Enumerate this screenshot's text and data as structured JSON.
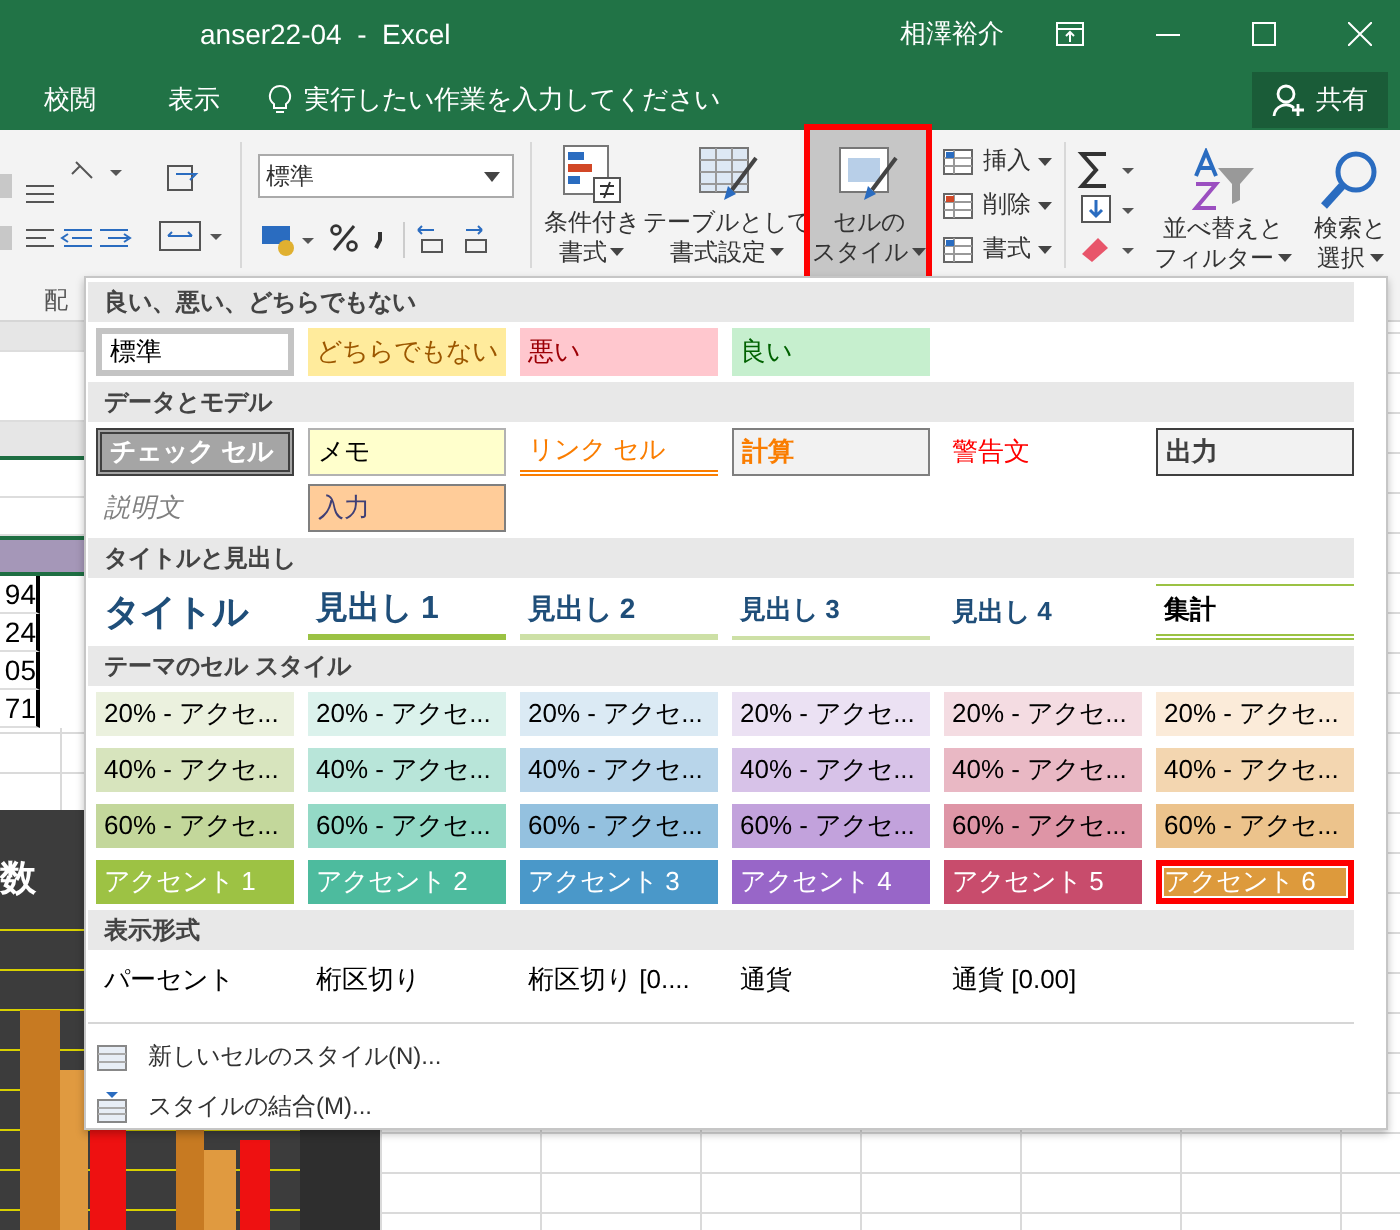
{
  "window": {
    "title": "anser22-04  -  Excel",
    "user": "相澤裕介"
  },
  "menu_tabs": [
    {
      "label": "校閲",
      "selected": false
    },
    {
      "label": "表示",
      "selected": false
    }
  ],
  "tell_me": {
    "placeholder": "実行したい作業を入力してください"
  },
  "share_button": "共有",
  "ribbon": {
    "number_format": "標準",
    "group_label": "配",
    "buttons": [
      {
        "kind": "conditional",
        "lines": [
          "条件付き",
          "書式"
        ],
        "selected": false
      },
      {
        "kind": "table",
        "lines": [
          "テーブルとして",
          "書式設定"
        ],
        "selected": false
      },
      {
        "kind": "styles",
        "lines": [
          "セルの",
          "スタイル"
        ],
        "selected": true
      }
    ],
    "cells_commands": [
      "挿入",
      "削除",
      "書式"
    ],
    "editing": [
      {
        "kind": "sort",
        "lines": [
          "並べ替えと",
          "フィルター"
        ]
      },
      {
        "kind": "find",
        "lines": [
          "検索と",
          "選択"
        ]
      }
    ]
  },
  "sheet": {
    "cells": [
      "94",
      "24",
      "05",
      "71"
    ],
    "chart_title": "数"
  },
  "gallery": {
    "sections": [
      {
        "title": "良い、悪い、どちらでもない",
        "items": [
          {
            "label": "標準",
            "kind": "normal",
            "selected": false
          },
          {
            "label": "どちらでもない",
            "kind": "neutral",
            "selected": false
          },
          {
            "label": "悪い",
            "kind": "bad",
            "selected": false
          },
          {
            "label": "良い",
            "kind": "good",
            "selected": false
          }
        ]
      },
      {
        "title": "データとモデル",
        "items": [
          {
            "label": "チェック セル",
            "kind": "check",
            "selected": false
          },
          {
            "label": "メモ",
            "kind": "note",
            "selected": false
          },
          {
            "label": "リンク セル",
            "kind": "link",
            "selected": false
          },
          {
            "label": "計算",
            "kind": "calc",
            "selected": false
          },
          {
            "label": "警告文",
            "kind": "warning",
            "selected": false
          },
          {
            "label": "出力",
            "kind": "output",
            "selected": false
          },
          {
            "label": "説明文",
            "kind": "explanatory",
            "selected": false
          },
          {
            "label": "入力",
            "kind": "input",
            "selected": false
          }
        ]
      },
      {
        "title": "タイトルと見出し",
        "items": [
          {
            "label": "タイトル",
            "kind": "title",
            "selected": false
          },
          {
            "label": "見出し 1",
            "kind": "heading1",
            "selected": false
          },
          {
            "label": "見出し 2",
            "kind": "heading2",
            "selected": false
          },
          {
            "label": "見出し 3",
            "kind": "heading3",
            "selected": false
          },
          {
            "label": "見出し 4",
            "kind": "heading4",
            "selected": false
          },
          {
            "label": "集計",
            "kind": "total",
            "selected": false
          }
        ]
      },
      {
        "title": "テーマのセル スタイル",
        "items": [
          {
            "label": "20% - アクセ...",
            "kind": "tint",
            "color": "#ebf1de",
            "selected": false
          },
          {
            "label": "20% - アクセ...",
            "kind": "tint",
            "color": "#dbf2ec",
            "selected": false
          },
          {
            "label": "20% - アクセ...",
            "kind": "tint",
            "color": "#dbeaf4",
            "selected": false
          },
          {
            "label": "20% - アクセ...",
            "kind": "tint",
            "color": "#ebe1f3",
            "selected": false
          },
          {
            "label": "20% - アクセ...",
            "kind": "tint",
            "color": "#f4dce2",
            "selected": false
          },
          {
            "label": "20% - アクセ...",
            "kind": "tint",
            "color": "#fbebd9",
            "selected": false
          },
          {
            "label": "40% - アクセ...",
            "kind": "tint",
            "color": "#d7e4bd",
            "selected": false
          },
          {
            "label": "40% - アクセ...",
            "kind": "tint",
            "color": "#b8e5d9",
            "selected": false
          },
          {
            "label": "40% - アクセ...",
            "kind": "tint",
            "color": "#b8d5ea",
            "selected": false
          },
          {
            "label": "40% - アクセ...",
            "kind": "tint",
            "color": "#d7c2e8",
            "selected": false
          },
          {
            "label": "40% - アクセ...",
            "kind": "tint",
            "color": "#e9b8c4",
            "selected": false
          },
          {
            "label": "40% - アクセ...",
            "kind": "tint",
            "color": "#f3d6b0",
            "selected": false
          },
          {
            "label": "60% - アクセ...",
            "kind": "tint",
            "color": "#c3d79b",
            "selected": false
          },
          {
            "label": "60% - アクセ...",
            "kind": "tint",
            "color": "#94d9c6",
            "selected": false
          },
          {
            "label": "60% - アクセ...",
            "kind": "tint",
            "color": "#94c1df",
            "selected": false
          },
          {
            "label": "60% - アクセ...",
            "kind": "tint",
            "color": "#c2a2dc",
            "selected": false
          },
          {
            "label": "60% - アクセ...",
            "kind": "tint",
            "color": "#de95a6",
            "selected": false
          },
          {
            "label": "60% - アクセ...",
            "kind": "tint",
            "color": "#ecc38c",
            "selected": false
          },
          {
            "label": "アクセント 1",
            "kind": "accent",
            "color": "#9dc244",
            "selected": false
          },
          {
            "label": "アクセント 2",
            "kind": "accent",
            "color": "#4dbb9e",
            "selected": false
          },
          {
            "label": "アクセント 3",
            "kind": "accent",
            "color": "#4a98c9",
            "selected": false
          },
          {
            "label": "アクセント 4",
            "kind": "accent",
            "color": "#9866c8",
            "selected": false
          },
          {
            "label": "アクセント 5",
            "kind": "accent",
            "color": "#c84c6c",
            "selected": false
          },
          {
            "label": "アクセント 6",
            "kind": "accent",
            "color": "#dd9a3c",
            "selected": true
          }
        ]
      },
      {
        "title": "表示形式",
        "items": [
          {
            "label": "パーセント",
            "kind": "plain",
            "selected": false
          },
          {
            "label": "桁区切り",
            "kind": "plain",
            "selected": false
          },
          {
            "label": "桁区切り [0....",
            "kind": "plain",
            "selected": false
          },
          {
            "label": "通貨",
            "kind": "plain",
            "selected": false
          },
          {
            "label": "通貨 [0.00]",
            "kind": "plain",
            "selected": false
          }
        ]
      }
    ],
    "commands": [
      {
        "label": "新しいセルのスタイル(N)...",
        "kind": "new"
      },
      {
        "label": "スタイルの結合(M)...",
        "kind": "merge"
      }
    ]
  }
}
